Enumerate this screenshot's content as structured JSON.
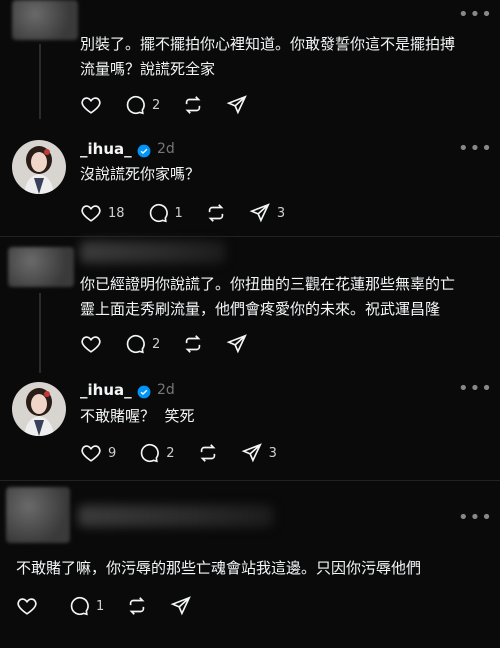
{
  "posts": [
    {
      "author": "",
      "text_lines": [
        "別裝了。擺不擺拍你心裡知道。你敢發誓你這不是擺拍搏",
        "流量嗎？說謊死全家"
      ],
      "likes": "",
      "replies": "2",
      "reposts": "",
      "shares": ""
    },
    {
      "author": "_ihua_",
      "time": "2d",
      "text_lines": [
        "沒說謊死你家嗎？"
      ],
      "likes": "18",
      "replies": "1",
      "reposts": "",
      "shares": "3"
    },
    {
      "author": "",
      "text_lines": [
        "你已經證明你說謊了。你扭曲的三觀在花蓮那些無辜的亡",
        "靈上面走秀刷流量，他們會疼愛你的未來。祝武運昌隆"
      ],
      "likes": "",
      "replies": "2",
      "reposts": "",
      "shares": ""
    },
    {
      "author": "_ihua_",
      "time": "2d",
      "text_lines": [
        "不敢賭喔？  笑死"
      ],
      "likes": "9",
      "replies": "2",
      "reposts": "",
      "shares": "3"
    },
    {
      "author": "",
      "text_lines": [
        "不敢賭了嘛，你污辱的那些亡魂會站我這邊。只因你污辱他們"
      ],
      "likes": "",
      "replies": "1",
      "reposts": "",
      "shares": ""
    }
  ],
  "colors": {
    "background": "#0a0a0a",
    "text": "#f3f5f7",
    "muted": "#777777",
    "verified": "#0095f6"
  },
  "icons": [
    "heart-icon",
    "comment-icon",
    "repost-icon",
    "share-icon",
    "more-icon",
    "verified-icon"
  ]
}
